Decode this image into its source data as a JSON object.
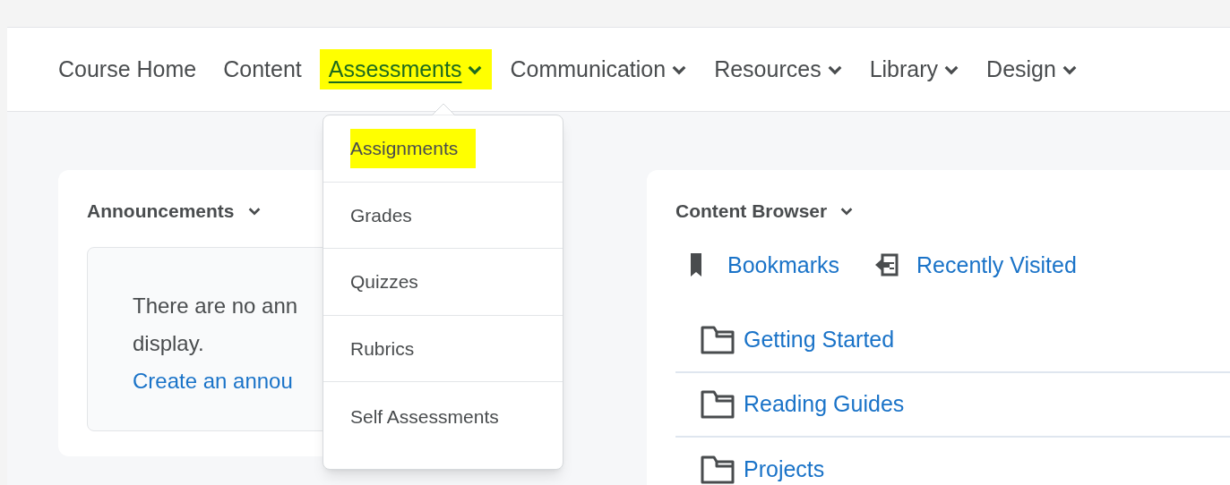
{
  "nav": [
    {
      "label": "Course Home",
      "dropdown": false,
      "selected": false,
      "highlighted": false
    },
    {
      "label": "Content",
      "dropdown": false,
      "selected": false,
      "highlighted": false
    },
    {
      "label": "Assessments",
      "dropdown": true,
      "selected": true,
      "highlighted": true
    },
    {
      "label": "Communication",
      "dropdown": true,
      "selected": false,
      "highlighted": false
    },
    {
      "label": "Resources",
      "dropdown": true,
      "selected": false,
      "highlighted": false
    },
    {
      "label": "Library",
      "dropdown": true,
      "selected": false,
      "highlighted": false
    },
    {
      "label": "Design",
      "dropdown": true,
      "selected": false,
      "highlighted": false
    }
  ],
  "menu": [
    {
      "label": "Assignments",
      "highlighted": true
    },
    {
      "label": "Grades",
      "highlighted": false
    },
    {
      "label": "Quizzes",
      "highlighted": false
    },
    {
      "label": "Rubrics",
      "highlighted": false
    },
    {
      "label": "Self Assessments",
      "highlighted": false
    }
  ],
  "announcements": {
    "title": "Announcements",
    "message_lines": [
      "There are no ann",
      "display."
    ],
    "link": "Create an annou"
  },
  "content_browser": {
    "title": "Content Browser",
    "bookmarks": "Bookmarks",
    "recently_visited": "Recently Visited",
    "folders": [
      "Getting Started",
      "Reading Guides",
      "Projects"
    ]
  }
}
